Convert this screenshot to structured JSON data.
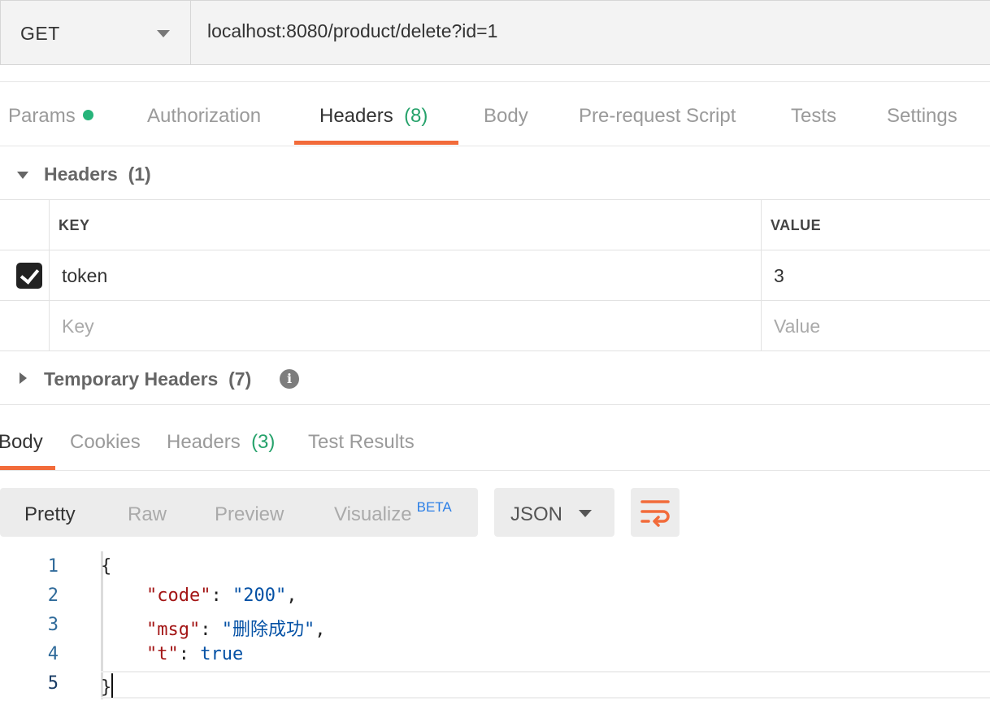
{
  "request": {
    "method": "GET",
    "url": "localhost:8080/product/delete?id=1"
  },
  "request_tabs": {
    "params": "Params",
    "authorization": "Authorization",
    "headers": "Headers",
    "headers_count": "(8)",
    "body": "Body",
    "pre_request": "Pre-request Script",
    "tests": "Tests",
    "settings": "Settings"
  },
  "headers_section": {
    "title": "Headers",
    "count": "(1)",
    "key_col": "KEY",
    "value_col": "VALUE",
    "rows": [
      {
        "key": "token",
        "value": "3",
        "checked": true
      }
    ],
    "key_placeholder": "Key",
    "value_placeholder": "Value"
  },
  "temporary_headers": {
    "title": "Temporary Headers",
    "count": "(7)"
  },
  "response_tabs": {
    "body": "Body",
    "cookies": "Cookies",
    "headers": "Headers",
    "headers_count": "(3)",
    "test_results": "Test Results"
  },
  "view_options": {
    "pretty": "Pretty",
    "raw": "Raw",
    "preview": "Preview",
    "visualize": "Visualize",
    "beta": "BETA",
    "format": "JSON"
  },
  "code": {
    "line_numbers": [
      "1",
      "2",
      "3",
      "4",
      "5"
    ],
    "open_brace": "{",
    "close_brace": "}",
    "lines": [
      {
        "key": "\"code\"",
        "value": "\"200\"",
        "trail": ","
      },
      {
        "key": "\"msg\"",
        "value": "\"删除成功\"",
        "trail": ","
      },
      {
        "key": "\"t\"",
        "value": "true",
        "trail": ""
      }
    ]
  },
  "colors": {
    "accent": "#f26b3a",
    "count_green": "#26a26b",
    "beta_blue": "#2c7fe6"
  }
}
